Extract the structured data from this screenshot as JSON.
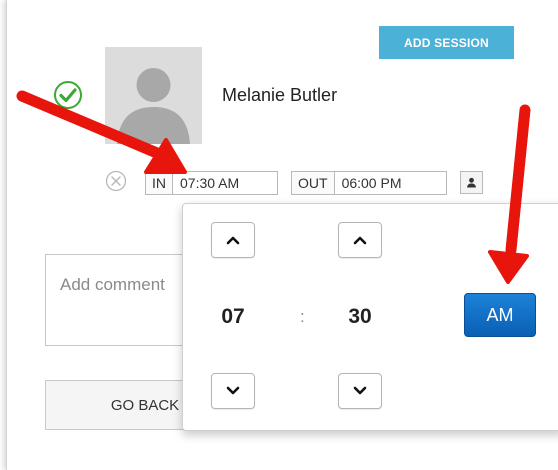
{
  "toolbar": {
    "add_session_label": "ADD SESSION"
  },
  "employee": {
    "name": "Melanie Butler"
  },
  "time_in": {
    "label": "IN",
    "value": "07:30 AM"
  },
  "time_out": {
    "label": "OUT",
    "value": "06:00 PM"
  },
  "comment": {
    "placeholder": "Add comment"
  },
  "go_back": {
    "label": "GO BACK"
  },
  "time_picker": {
    "hour": "07",
    "separator": ":",
    "minute": "30",
    "meridiem": "AM"
  },
  "icons": {
    "status": "check-circle-icon",
    "remove": "x-circle-icon",
    "person": "person-icon",
    "up": "chevron-up-icon",
    "down": "chevron-down-icon",
    "avatar": "user-silhouette-icon"
  },
  "colors": {
    "accent_button": "#4cb1d6",
    "check_green": "#3aa935",
    "meridiem_button": "#0a6ac3",
    "annotation_arrow": "#e8150c"
  }
}
